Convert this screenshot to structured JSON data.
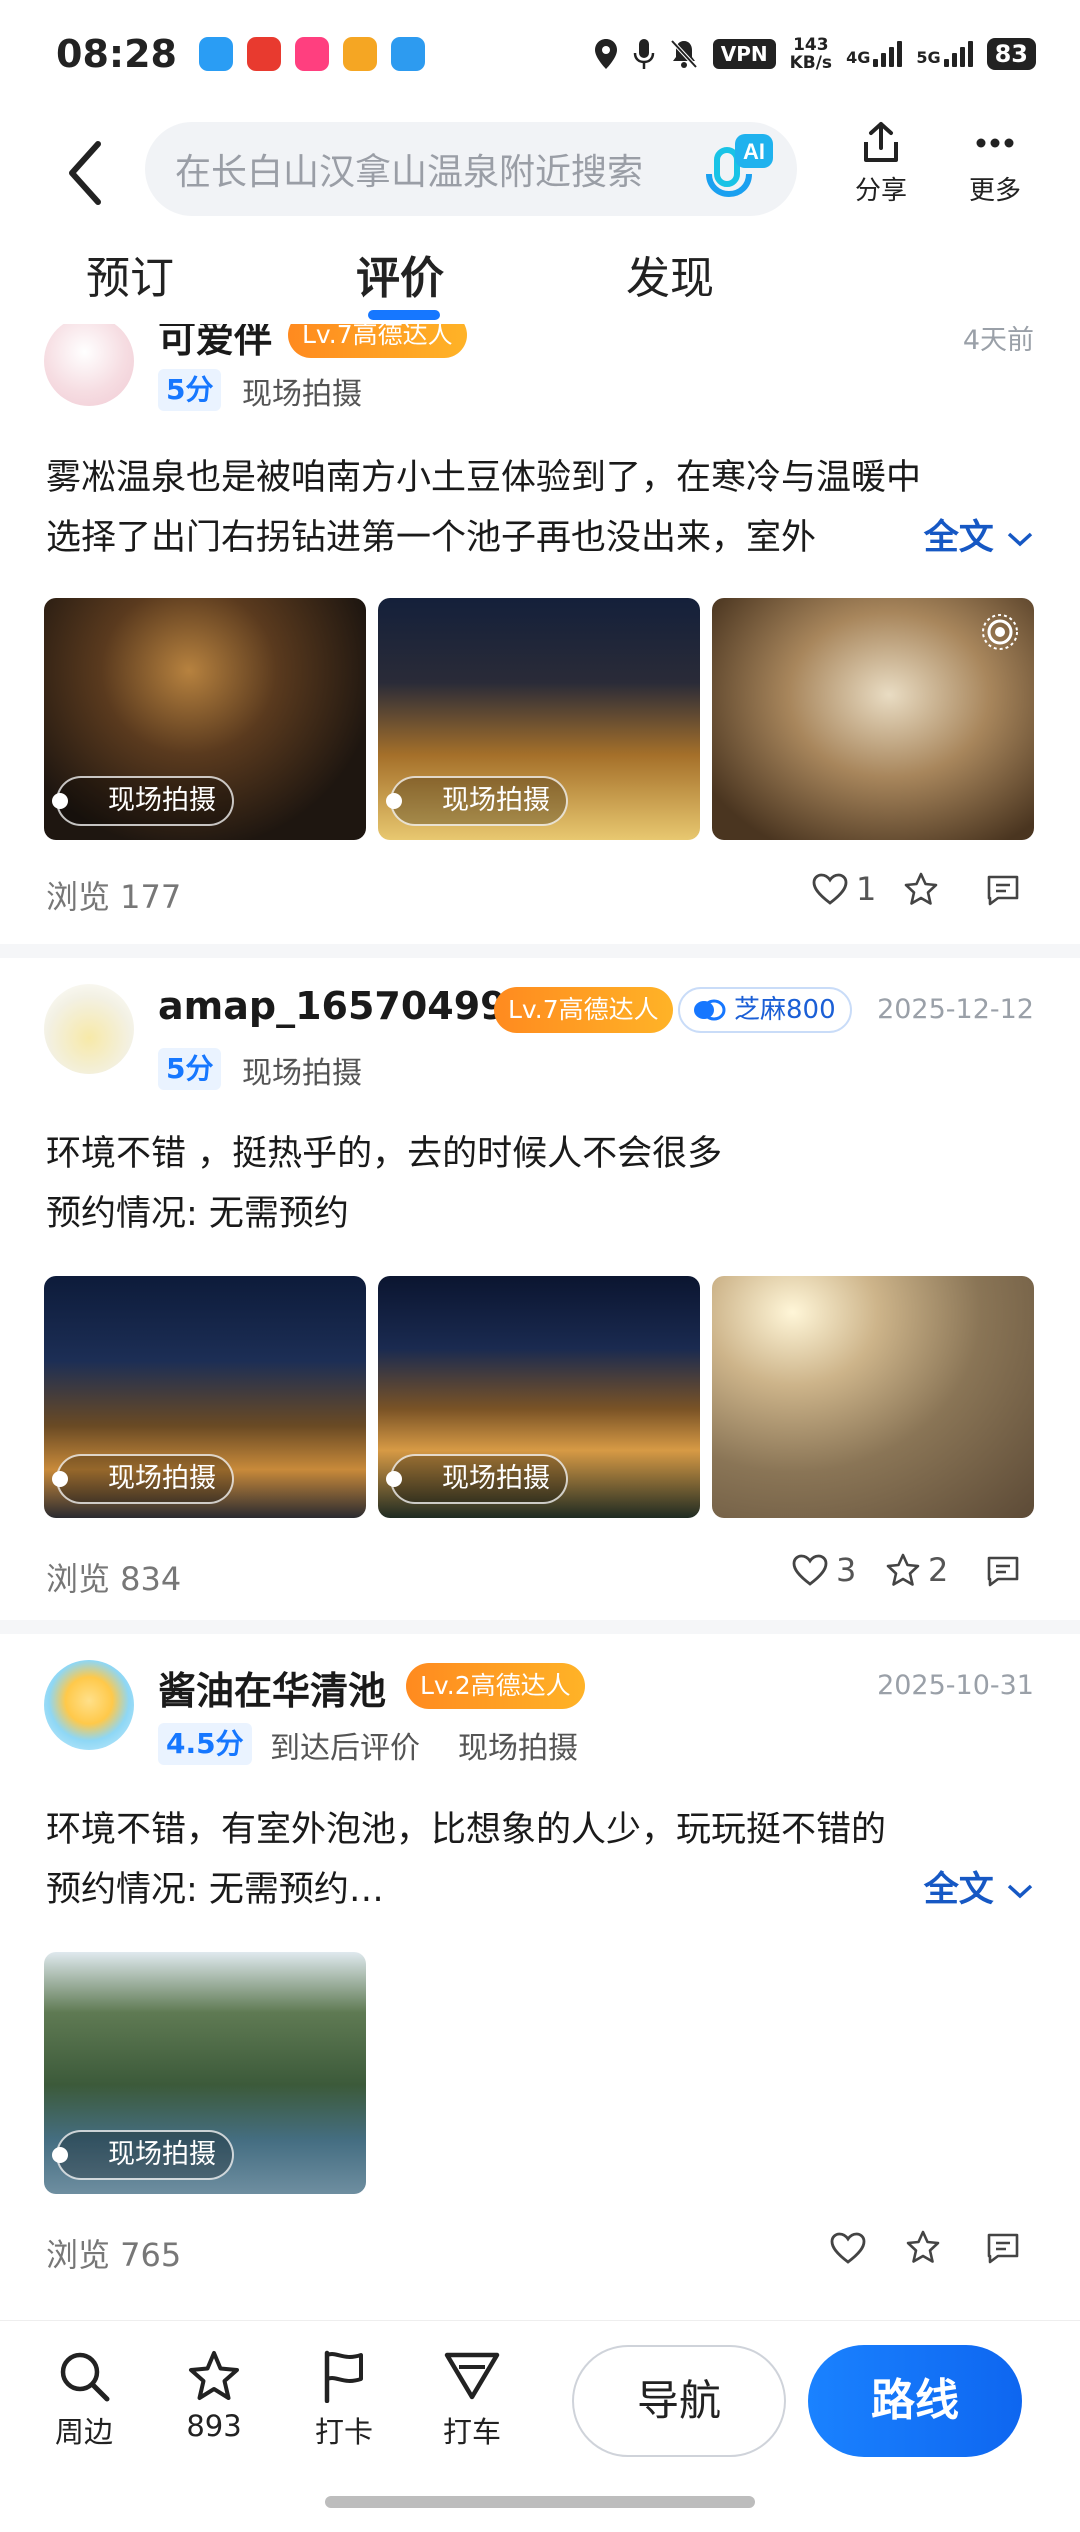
{
  "status_bar": {
    "time": "08:28",
    "vpn": "VPN",
    "net_speed_value": "143",
    "net_speed_unit": "KB/s",
    "sig1": "4G",
    "sig2": "5G",
    "battery": "83"
  },
  "header": {
    "search_placeholder": "在长白山汉拿山温泉附近搜索",
    "ai_label": "AI",
    "share_label": "分享",
    "more_label": "更多"
  },
  "tabs": [
    {
      "label": "预订"
    },
    {
      "label": "评价"
    },
    {
      "label": "发现"
    }
  ],
  "reviews": [
    {
      "username": "可爱伴",
      "level": "Lv.7高德达人",
      "date": "4天前",
      "score": "5分",
      "tags": [
        "现场拍摄"
      ],
      "text_line1": "雾凇温泉也是被咱南方小土豆体验到了，在寒冷与温暖中",
      "text_line2": "选择了出门右拐钻进第一个池子再也没出来，室外",
      "more": "全文",
      "photo_badge": "现场拍摄",
      "views": "浏览 177",
      "likes": "1",
      "favorites": "",
      "comments": ""
    },
    {
      "username": "amap_165704995",
      "level": "Lv.7高德达人",
      "zhima": "芝麻800",
      "date": "2025-12-12",
      "score": "5分",
      "tags": [
        "现场拍摄"
      ],
      "text_line1": "环境不错 ，挺热乎的，去的时候人不会很多",
      "text_line2": "预约情况: 无需预约",
      "photo_badge": "现场拍摄",
      "views": "浏览 834",
      "likes": "3",
      "favorites": "2",
      "comments": ""
    },
    {
      "username": "酱油在华清池",
      "level": "Lv.2高德达人",
      "date": "2025-10-31",
      "score": "4.5分",
      "tags": [
        "到达后评价",
        "现场拍摄"
      ],
      "text_line1": "环境不错，有室外泡池，比想象的人少，玩玩挺不错的",
      "text_line2": "预约情况: 无需预约…",
      "more": "全文",
      "photo_badge": "现场拍摄",
      "views": "浏览 765",
      "likes": "",
      "favorites": "",
      "comments": ""
    }
  ],
  "bottom_bar": {
    "nearby": "周边",
    "favorites_count": "893",
    "checkin": "打卡",
    "taxi": "打车",
    "navigate": "导航",
    "route": "路线"
  },
  "colors": {
    "accent": "#1677ff",
    "level_badge": "#ff9a1f",
    "link": "#1658c4"
  }
}
